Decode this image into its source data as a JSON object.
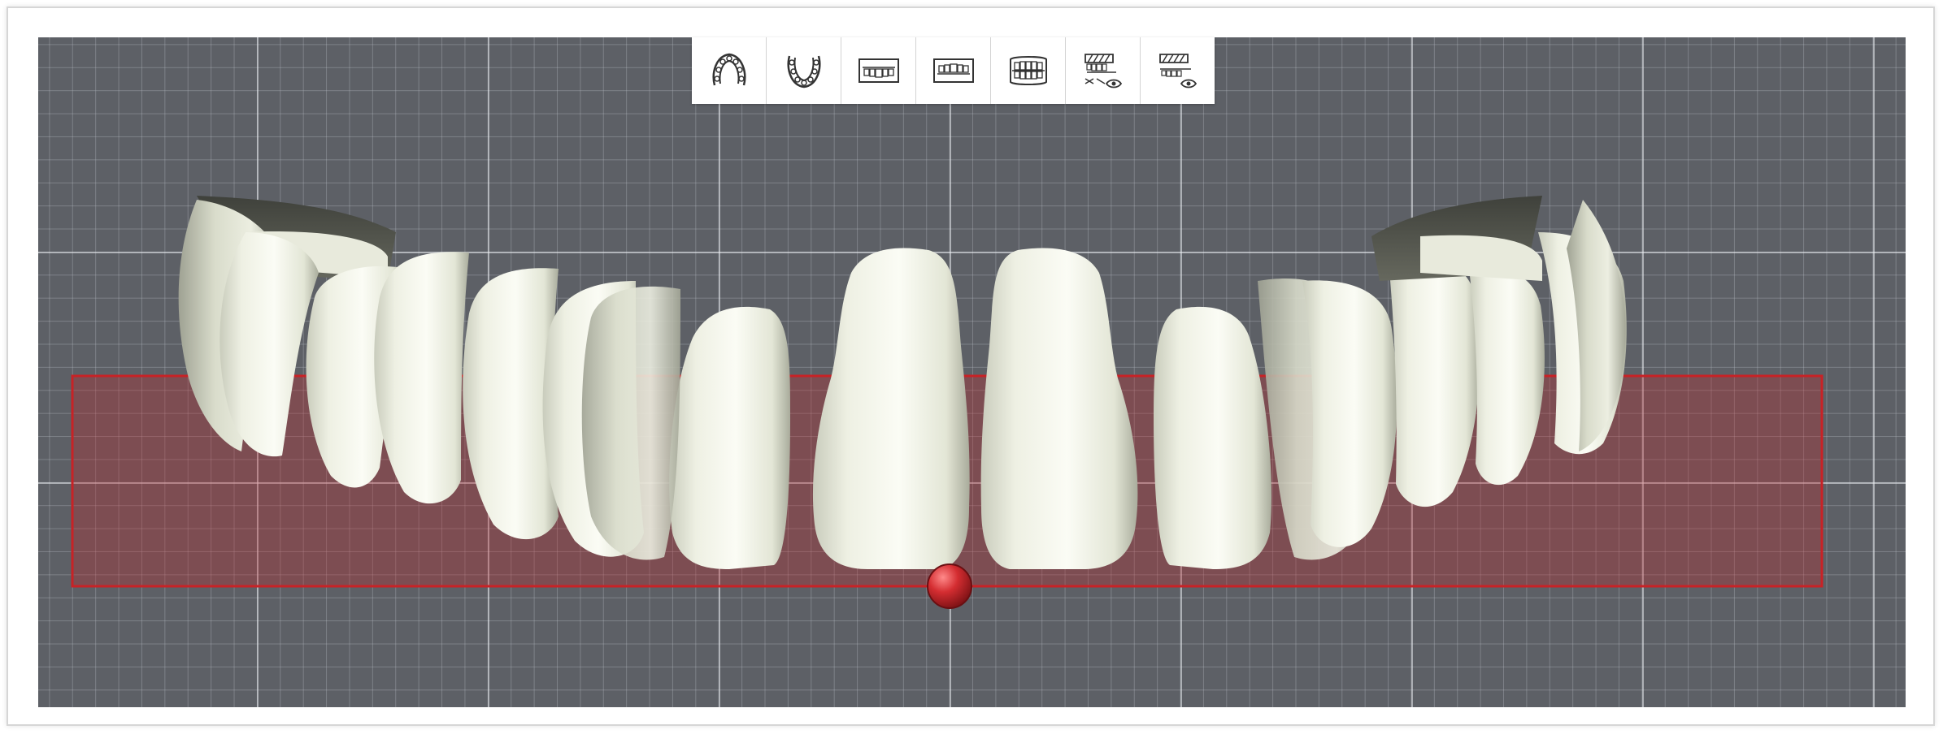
{
  "app": {
    "name": "",
    "view": "dental-arch-3d-viewport"
  },
  "toolbar": {
    "buttons": [
      {
        "id": "upper-jaw-view",
        "icon": "upper-arch-occlusal-icon"
      },
      {
        "id": "lower-jaw-view",
        "icon": "lower-arch-occlusal-icon"
      },
      {
        "id": "upper-teeth-front",
        "icon": "upper-teeth-frontal-icon"
      },
      {
        "id": "lower-teeth-front",
        "icon": "lower-teeth-frontal-icon"
      },
      {
        "id": "both-jaws-front",
        "icon": "both-jaws-frontal-icon"
      },
      {
        "id": "toggle-upper-visibility",
        "icon": "upper-jaw-visibility-icon"
      },
      {
        "id": "toggle-lower-visibility",
        "icon": "lower-jaw-visibility-icon"
      }
    ]
  },
  "viewport": {
    "background": "#5d6066",
    "grid": true,
    "selection_plane_color": "#c0262a",
    "control_point_color": "#cc2a2e",
    "tooth_color": "#eef0e3"
  }
}
